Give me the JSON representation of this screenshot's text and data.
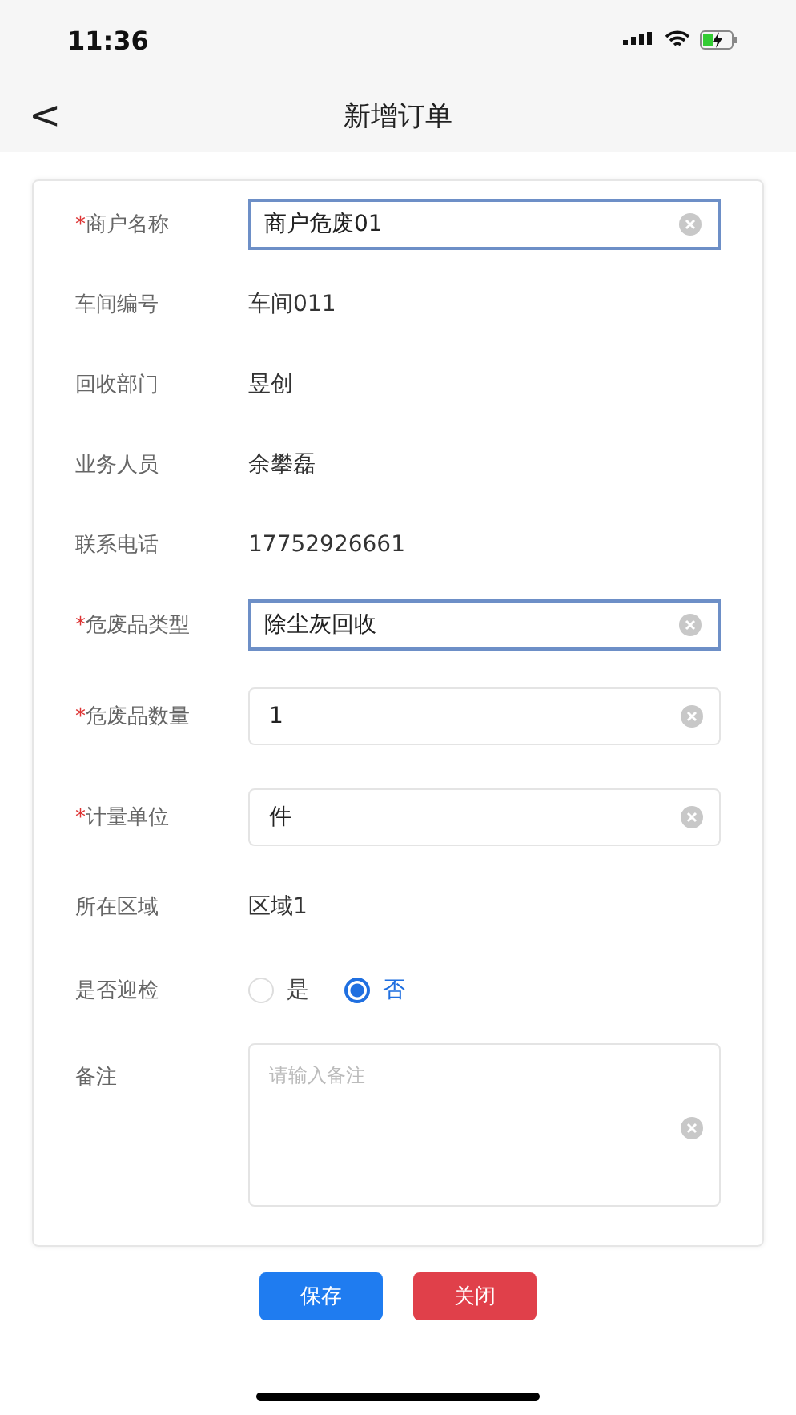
{
  "status_bar": {
    "time": "11:36"
  },
  "nav": {
    "back": "<",
    "title": "新增订单"
  },
  "fields": [
    {
      "kind": "input",
      "required_mark": "*",
      "label": "商户名称",
      "value": "商户危废01",
      "focused": true
    },
    {
      "kind": "text",
      "label": "车间编号",
      "value": "车间011"
    },
    {
      "kind": "text",
      "label": "回收部门",
      "value": "昱创"
    },
    {
      "kind": "text",
      "label": "业务人员",
      "value": "余攀磊"
    },
    {
      "kind": "text",
      "label": "联系电话",
      "value": "17752926661"
    },
    {
      "kind": "input",
      "required_mark": "*",
      "label": "危废品类型",
      "value": "除尘灰回收",
      "focused": true
    },
    {
      "kind": "input",
      "required_mark": "*",
      "label": "危废品数量",
      "value": "1",
      "focused": false
    },
    {
      "kind": "input",
      "required_mark": "*",
      "label": "计量单位",
      "value": "件",
      "focused": false
    },
    {
      "kind": "text",
      "label": "所在区域",
      "value": "区域1"
    },
    {
      "kind": "radio",
      "label": "是否迎检",
      "options": [
        {
          "label": "是",
          "selected": false
        },
        {
          "label": "否",
          "selected": true
        }
      ]
    },
    {
      "kind": "textarea",
      "label": "备注",
      "placeholder": "请输入备注"
    }
  ],
  "buttons": [
    {
      "label": "保存",
      "kind": "primary"
    },
    {
      "label": "关闭",
      "kind": "danger"
    }
  ]
}
